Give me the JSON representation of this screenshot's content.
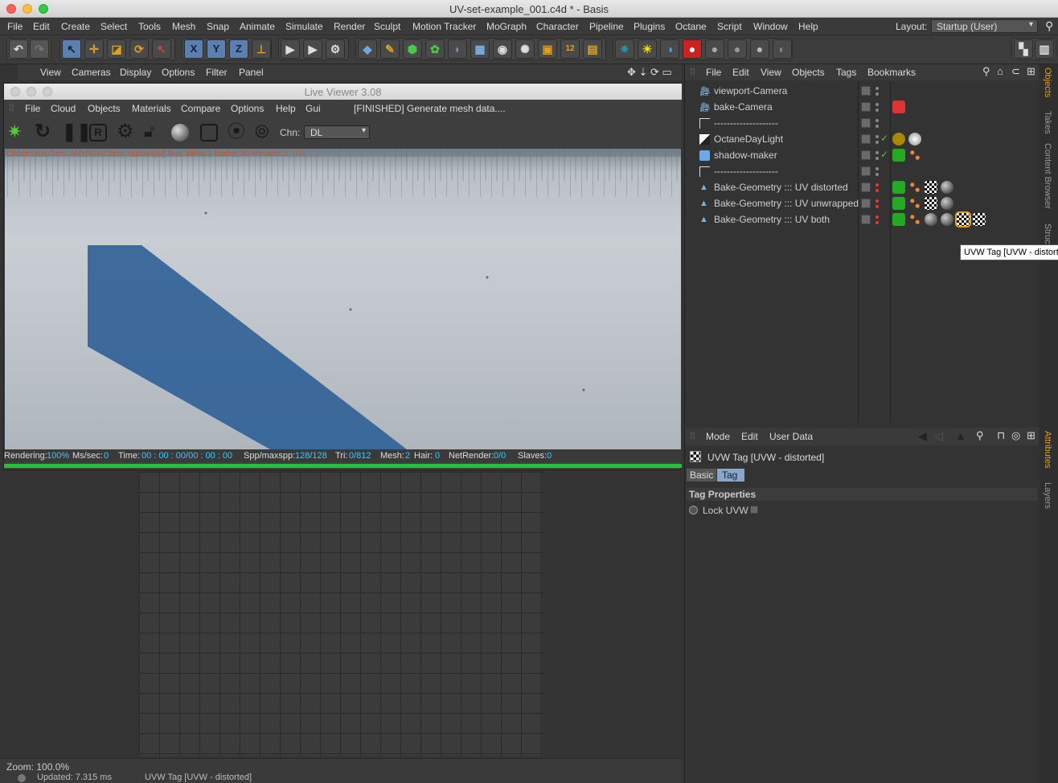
{
  "window": {
    "title": "UV-set-example_001.c4d * - Basis"
  },
  "menubar": {
    "items": [
      "File",
      "Edit",
      "Create",
      "Select",
      "Tools",
      "Mesh",
      "Snap",
      "Animate",
      "Simulate",
      "Render",
      "Sculpt",
      "Motion Tracker",
      "MoGraph",
      "Character",
      "Pipeline",
      "Plugins",
      "Octane",
      "Script",
      "Window",
      "Help"
    ],
    "layout_label": "Layout:",
    "layout_value": "Startup (User)"
  },
  "viewport_menu": {
    "items": [
      "View",
      "Cameras",
      "Display",
      "Options",
      "Filter",
      "Panel"
    ]
  },
  "live_viewer": {
    "title": "Live Viewer 3.08",
    "menu": [
      "File",
      "Cloud",
      "Objects",
      "Materials",
      "Compare",
      "Options",
      "Help",
      "Gui"
    ],
    "status_message": "[FINISHED] Generate mesh data....",
    "channel_label": "Chn:",
    "channel_value": "DL",
    "overlay_text": "Check:0ms./2ms. MeshGen:0ms. Update[G]:7ms. Mesh:1 Nodes:20 Movable:2 :0 0",
    "stats": {
      "rendering_label": "Rendering:",
      "rendering": "100%",
      "mssec_label": "Ms/sec:",
      "mssec": "0",
      "time_label": "Time:",
      "time": "00 : 00 : 00/00 : 00 : 00",
      "spp_label": "Spp/maxspp:",
      "spp": "128/128",
      "tri_label": "Tri:",
      "tri": "0/812",
      "mesh_label": "Mesh:",
      "mesh": "2",
      "hair_label": "Hair:",
      "hair": "0",
      "netrender_label": "NetRender:",
      "netrender": "0/0",
      "slaves_label": "Slaves:",
      "slaves": "0"
    },
    "progress": 1.0
  },
  "zoom": {
    "text": "Zoom: 100.0%"
  },
  "statusbar": {
    "updated": "Updated: 7.315 ms",
    "selection": "UVW Tag [UVW - distorted]"
  },
  "object_manager": {
    "menu": [
      "File",
      "Edit",
      "View",
      "Objects",
      "Tags",
      "Bookmarks"
    ],
    "objects": [
      {
        "name": "viewport-Camera",
        "icon": "camera-icon"
      },
      {
        "name": "bake-Camera",
        "icon": "camera-icon"
      },
      {
        "name": "--------------------",
        "icon": "null-icon"
      },
      {
        "name": "OctaneDayLight",
        "icon": "daylight-icon"
      },
      {
        "name": "shadow-maker",
        "icon": "cube-icon"
      },
      {
        "name": "--------------------",
        "icon": "null-icon"
      },
      {
        "name": "Bake-Geometry ::: UV distorted",
        "icon": "polygon-icon"
      },
      {
        "name": "Bake-Geometry ::: UV unwrapped",
        "icon": "polygon-icon"
      },
      {
        "name": "Bake-Geometry ::: UV both",
        "icon": "polygon-icon"
      }
    ],
    "tooltip": "UVW Tag [UVW - distorted]"
  },
  "attribute_manager": {
    "menu": [
      "Mode",
      "Edit",
      "User Data"
    ],
    "header": "UVW Tag [UVW - distorted]",
    "tabs": [
      "Basic",
      "Tag"
    ],
    "section": "Tag Properties",
    "lock_uvw_label": "Lock UVW"
  },
  "side_tabs": {
    "top": [
      "Objects",
      "Takes",
      "Content Browser",
      "Structure"
    ],
    "bottom": [
      "Attributes",
      "Layers"
    ]
  }
}
